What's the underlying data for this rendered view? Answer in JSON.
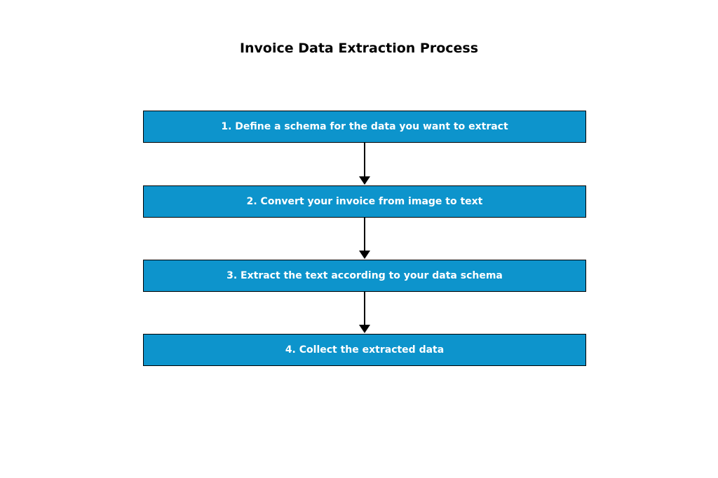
{
  "title": "Invoice Data Extraction Process",
  "steps": [
    {
      "label": "1. Define a schema for the data you want to extract"
    },
    {
      "label": "2. Convert your invoice from image to text"
    },
    {
      "label": "3. Extract the text according to your data schema"
    },
    {
      "label": "4. Collect the extracted data"
    }
  ],
  "chart_data": {
    "type": "flowchart",
    "title": "Invoice Data Extraction Process",
    "nodes": [
      {
        "id": 1,
        "text": "1. Define a schema for the data you want to extract"
      },
      {
        "id": 2,
        "text": "2. Convert your invoice from image to text"
      },
      {
        "id": 3,
        "text": "3. Extract the text according to your data schema"
      },
      {
        "id": 4,
        "text": "4. Collect the extracted data"
      }
    ],
    "edges": [
      {
        "from": 1,
        "to": 2
      },
      {
        "from": 2,
        "to": 3
      },
      {
        "from": 3,
        "to": 4
      }
    ],
    "node_color": "#0d94cc",
    "node_text_color": "#ffffff",
    "layout": "vertical"
  }
}
